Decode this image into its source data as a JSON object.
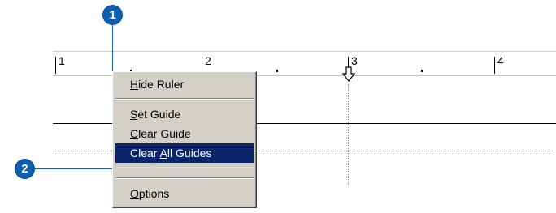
{
  "ruler": {
    "numbers": [
      "1",
      "2",
      "3",
      "4"
    ]
  },
  "menu": {
    "hide_ruler": {
      "mnemonic": "H",
      "rest": "ide Ruler"
    },
    "set_guide": {
      "mnemonic": "S",
      "rest": "et Guide"
    },
    "clear_guide": {
      "mnemonic": "C",
      "rest": "lear Guide"
    },
    "clear_all_guides": {
      "before": "Clear ",
      "mnemonic": "A",
      "rest": "ll Guides"
    },
    "options": {
      "mnemonic": "O",
      "rest": "ptions"
    },
    "selected_item": "Clear All Guides"
  },
  "callouts": {
    "first": "1",
    "second": "2"
  },
  "colors": {
    "callout": "#0d5fae",
    "menu_background": "#d4d0c8",
    "menu_highlight": "#0a246a",
    "guide_vertical": "#3fa9c8"
  }
}
